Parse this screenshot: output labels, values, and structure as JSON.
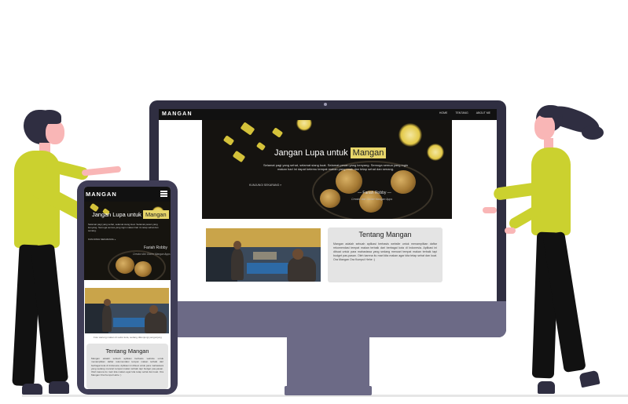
{
  "desktop_site": {
    "logo": "MANGAN",
    "nav_links": [
      "HOME",
      "TENTANG",
      "ABOUT ME"
    ],
    "hero": {
      "title_prefix": "Jangan Lupa untuk",
      "title_highlight": "Mangan",
      "paragraph": "Selamat pagi yang sehat, selamat siang kuat. Selamat pesan yang kenyang. Semoga semua yang ingin makan hari ini dapat ketemu tempat makan yang enak dan tetap sehat dan senang.",
      "button": "KUNJUNGI SEKARANG »",
      "author": "— Fariah Robby —",
      "author_role": "Creator dan Owner Mangan Apps"
    },
    "about": {
      "title": "Tentang Mangan",
      "text": "Mangan adalah sebuah aplikasi berbasis website untuk menampilkan daftar rekomendasi tempat makan terbaik dari berbagai kota di Indonesia. Aplikasi ini dibuat untuk para mahasiswa yang sedang mencari tempat makan terbaik tapi budget pas-pasan. Oleh karena itu mari kita makan agar kita tetap sehat dan kuat. Ora Mangan Ora Kumpul Hehe :)"
    }
  },
  "mobile_site": {
    "logo": "MANGAN",
    "hero": {
      "title_prefix": "Jangan Lupa untuk",
      "title_highlight": "Mangan",
      "paragraph": "Selamat pagi yang sehat, selamat siang kuat. Selamat pesan yang kenyang. Semoga semua yang ingin makan hari ini tetap sehat dan senang.",
      "button": "KUNJUNGI SEKARANG »",
      "author": "Fariah Robby",
      "author_role": "Creator dan Owner Mangan Apps"
    },
    "photo_caption": "Foto warung makan di sudut kota, sedang dikunjungi pengunjung",
    "about": {
      "title": "Tentang Mangan",
      "text": "Mangan adalah sebuah aplikasi berbasis website untuk menampilkan daftar rekomendasi tempat makan terbaik dari berbagai kota di Indonesia. Aplikasi ini dibuat untuk para mahasiswa yang sedang mencari tempat makan terbaik tapi budget pas-pasan. Oleh karena itu mari kita makan agar kita tetap sehat dan kuat. Ora Mangan Ora Kumpul Hehe :)"
    }
  },
  "colors": {
    "device_dark": "#2f2e41",
    "stand": "#6c6a86",
    "highlight": "#e8d66a",
    "shirt": "#cbd12f",
    "skin": "#f9b6b6"
  }
}
